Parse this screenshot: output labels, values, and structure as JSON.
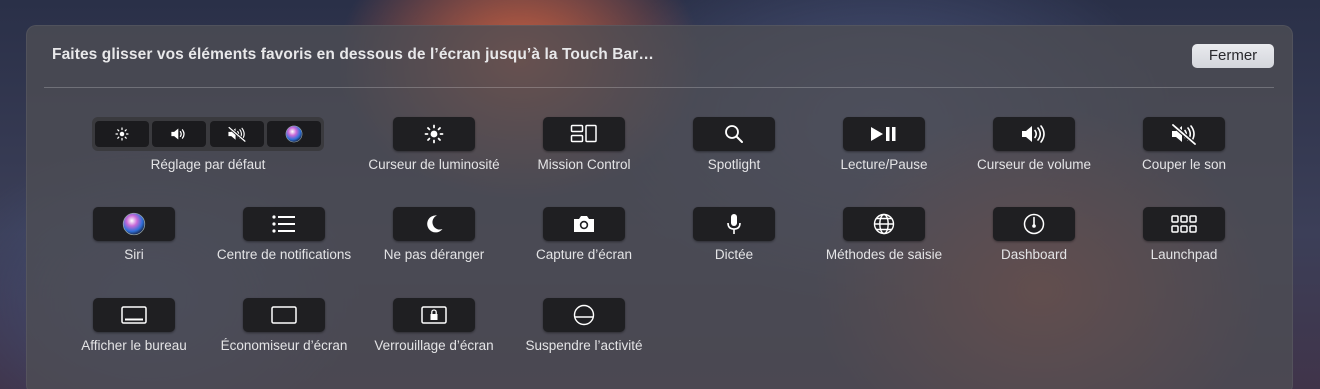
{
  "header": {
    "title": "Faites glisser vos éléments favoris en dessous de l’écran jusqu’à la Touch Bar…",
    "close_label": "Fermer"
  },
  "default_set": {
    "label": "Réglage par défaut",
    "icons": [
      "brightness-icon",
      "volume-icon",
      "mute-icon",
      "siri-icon"
    ]
  },
  "items": [
    {
      "label": "Curseur de luminosité",
      "icon": "brightness-icon"
    },
    {
      "label": "Mission Control",
      "icon": "mission-control-icon"
    },
    {
      "label": "Spotlight",
      "icon": "search-icon"
    },
    {
      "label": "Lecture/Pause",
      "icon": "play-pause-icon"
    },
    {
      "label": "Curseur de volume",
      "icon": "volume-icon"
    },
    {
      "label": "Couper le son",
      "icon": "mute-icon"
    },
    {
      "label": "Siri",
      "icon": "siri-icon"
    },
    {
      "label": "Centre de notifications",
      "icon": "notification-list-icon"
    },
    {
      "label": "Ne pas déranger",
      "icon": "moon-icon"
    },
    {
      "label": "Capture d’écran",
      "icon": "camera-icon"
    },
    {
      "label": "Dictée",
      "icon": "microphone-icon"
    },
    {
      "label": "Méthodes de saisie",
      "icon": "globe-icon"
    },
    {
      "label": "Dashboard",
      "icon": "dashboard-gauge-icon"
    },
    {
      "label": "Launchpad",
      "icon": "launchpad-grid-icon"
    },
    {
      "label": "Afficher le bureau",
      "icon": "desktop-icon"
    },
    {
      "label": "Économiseur d’écran",
      "icon": "screensaver-icon"
    },
    {
      "label": "Verrouillage d’écran",
      "icon": "lock-screen-icon"
    },
    {
      "label": "Suspendre l’activité",
      "icon": "sleep-icon"
    }
  ]
}
